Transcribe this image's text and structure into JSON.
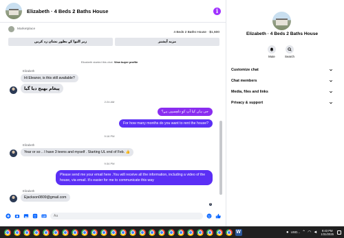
{
  "chat_header": {
    "title": "Elizabeth · 4 Beds 2 Baths House",
    "info_icon": "info-icon",
    "accent_color": "#a033ff"
  },
  "listing": {
    "category": "Marketplace",
    "title_price": "4 Beds 2 Baths House · $1,600",
    "button_left": "زیر التوا کے بطور نشان زد کریں",
    "button_right": "مزید آپشنز"
  },
  "messages": {
    "system_started": "Elizabeth started this chat.",
    "view_profile": "View buyer profile",
    "sender_1": "Elizabeth",
    "msg_1": "Hi Eleanor, is this still available?",
    "msg_2": "پیغام بھیج دیا گیا",
    "time_1": "2:24 AM",
    "msg_3": "جی ہاں کیا آپ کو دلچسپی ہے؟",
    "msg_4": "For how many months do you want to rent the house?",
    "time_2": "9:16 PM",
    "sender_2": "Elizabeth",
    "msg_5": "Year or so .. I have 3 teens and myself . Starting UL end of Feb. 👍",
    "time_3": "9:34 PM",
    "msg_6": "Please send me your email here .You will receive all the information, including a video of the house, via email. It's easier for me to communicate this way",
    "sender_3": "Elizabeth",
    "msg_7": "Ejackson0809@gmail.com",
    "outgoing_color": "#5b2ff5"
  },
  "composer": {
    "placeholder": "Aa",
    "accent_color": "#0866ff"
  },
  "info_panel": {
    "name": "Elizabeth · 4 Beds 2 Baths House",
    "mute_label": "Mute",
    "search_label": "Search",
    "sections": [
      "Customize chat",
      "Chat members",
      "Media, files and links",
      "Privacy & support"
    ]
  },
  "taskbar": {
    "apps": [
      "chrome-icon",
      "word-icon"
    ],
    "language": "USD...",
    "time": "9:43 PM",
    "date": "1/31/2025",
    "background": "#202020"
  }
}
